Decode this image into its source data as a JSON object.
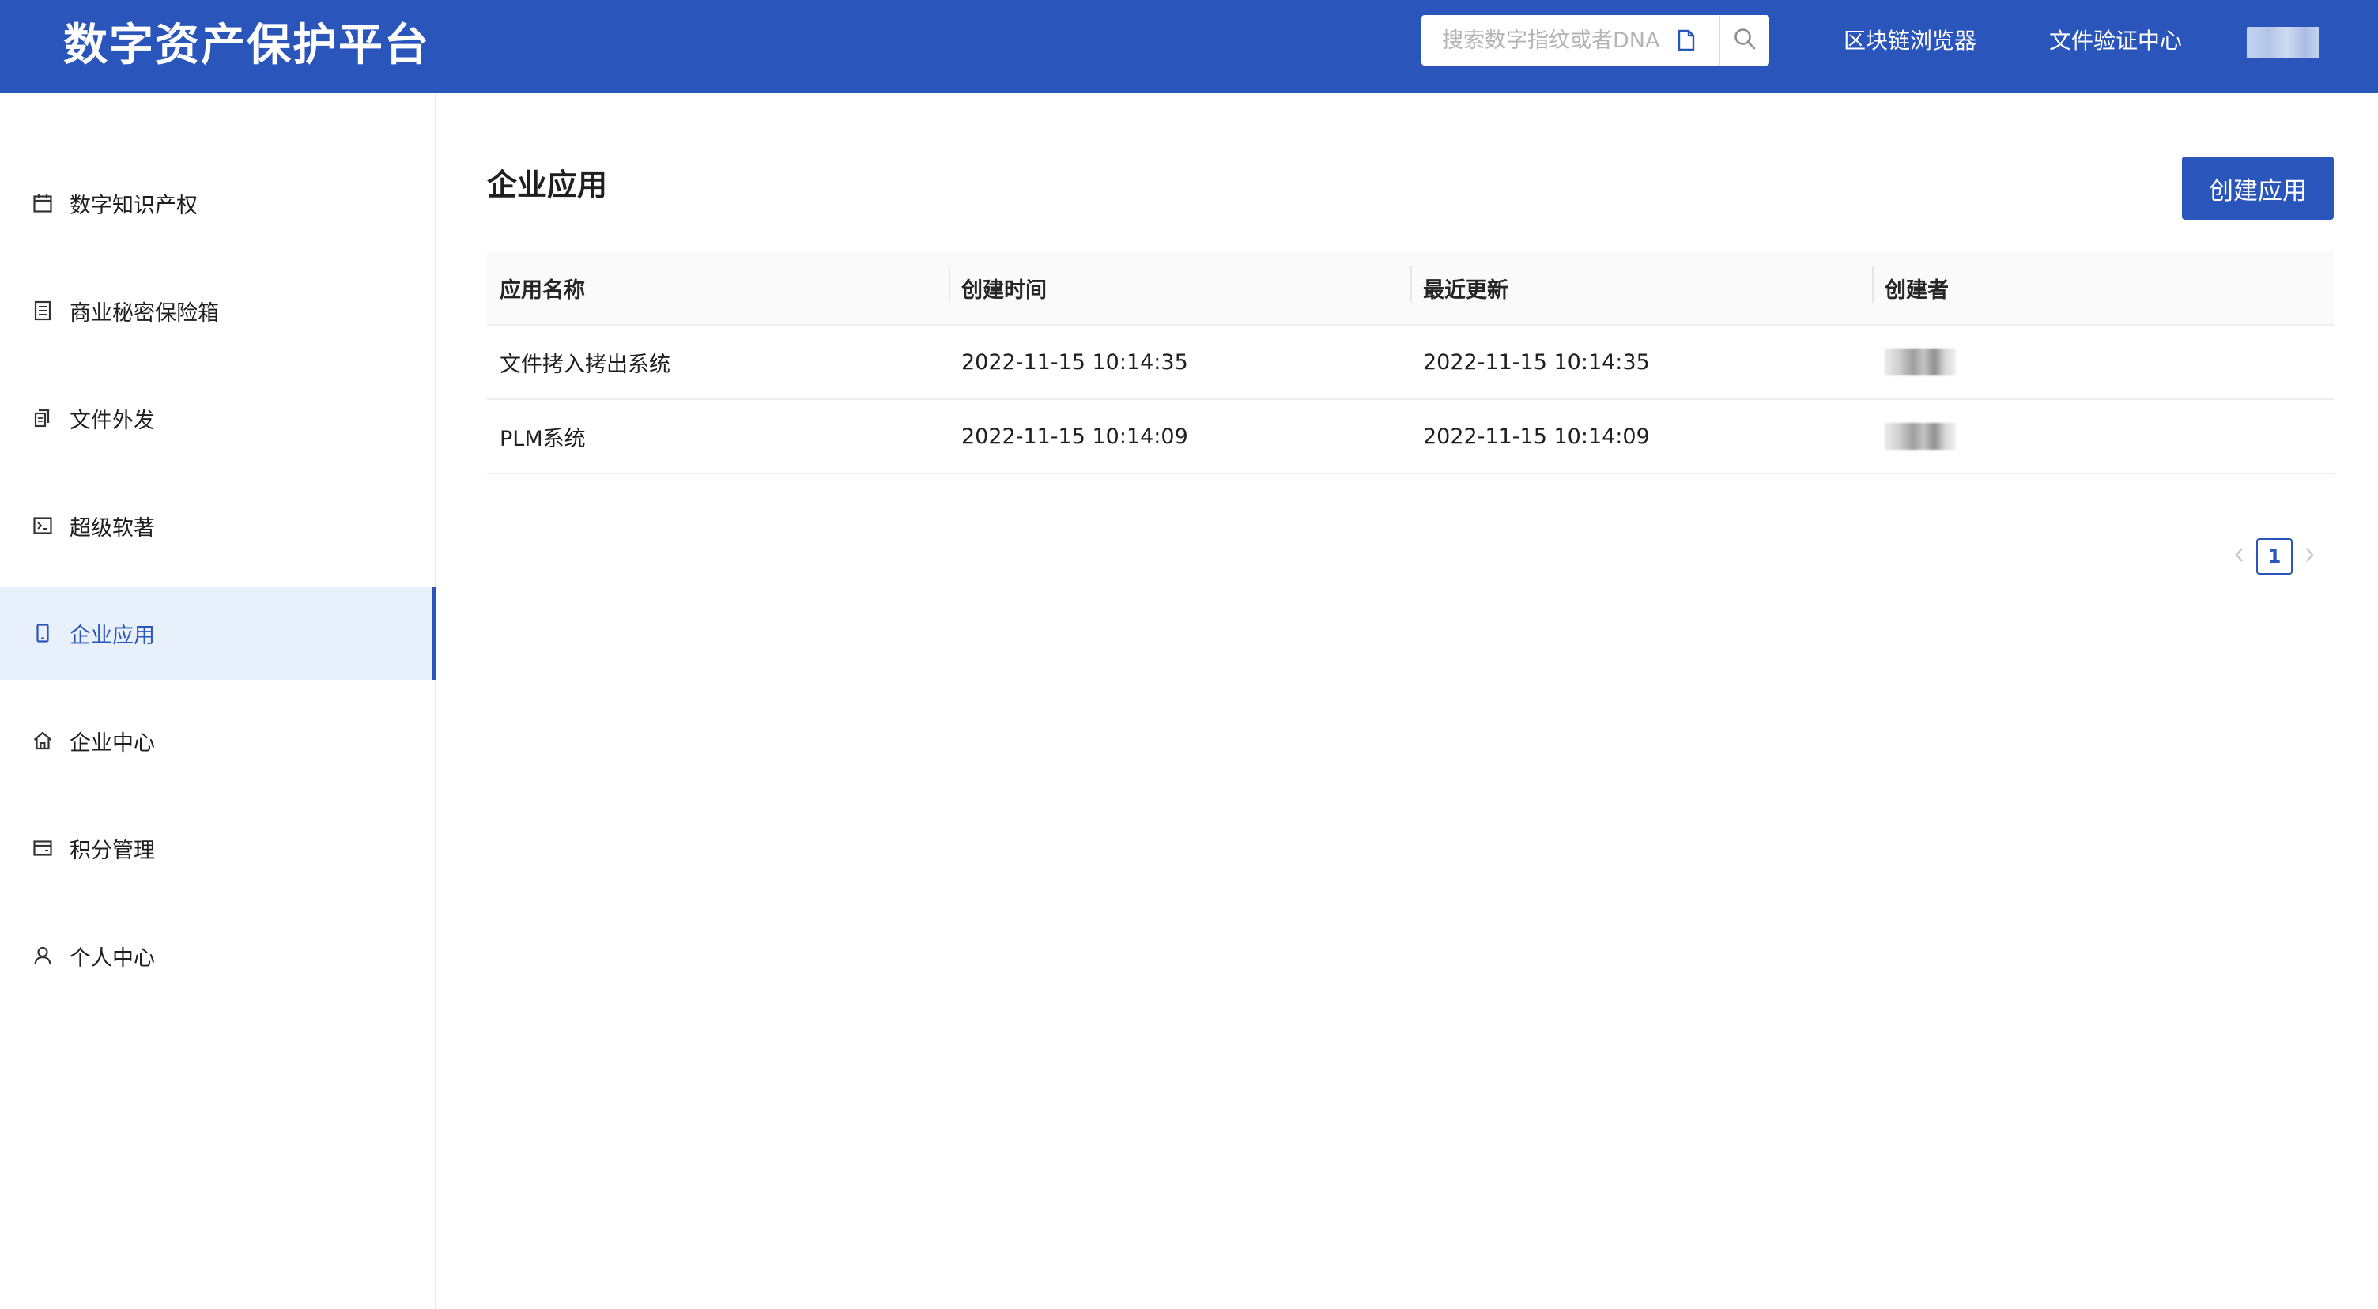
{
  "header": {
    "logo": "数字资产保护平台",
    "search_placeholder": "搜索数字指纹或者DNA",
    "nav": [
      "区块链浏览器",
      "文件验证中心"
    ]
  },
  "sidebar": {
    "items": [
      {
        "label": "数字知识产权",
        "icon": "calendar-icon",
        "active": false
      },
      {
        "label": "商业秘密保险箱",
        "icon": "safe-box-icon",
        "active": false
      },
      {
        "label": "文件外发",
        "icon": "documents-icon",
        "active": false
      },
      {
        "label": "超级软著",
        "icon": "terminal-icon",
        "active": false
      },
      {
        "label": "企业应用",
        "icon": "mobile-icon",
        "active": true
      },
      {
        "label": "企业中心",
        "icon": "home-icon",
        "active": false
      },
      {
        "label": "积分管理",
        "icon": "card-icon",
        "active": false
      },
      {
        "label": "个人中心",
        "icon": "user-icon",
        "active": false
      }
    ]
  },
  "main": {
    "title": "企业应用",
    "create_button": "创建应用",
    "table": {
      "columns": [
        "应用名称",
        "创建时间",
        "最近更新",
        "创建者"
      ],
      "rows": [
        {
          "name": "文件拷入拷出系统",
          "created": "2022-11-15 10:14:35",
          "updated": "2022-11-15 10:14:35"
        },
        {
          "name": "PLM系统",
          "created": "2022-11-15 10:14:09",
          "updated": "2022-11-15 10:14:09"
        }
      ]
    },
    "pagination": {
      "current": "1"
    }
  },
  "colors": {
    "brand": "#2a55bb",
    "active_bg": "#e8f0fb"
  }
}
